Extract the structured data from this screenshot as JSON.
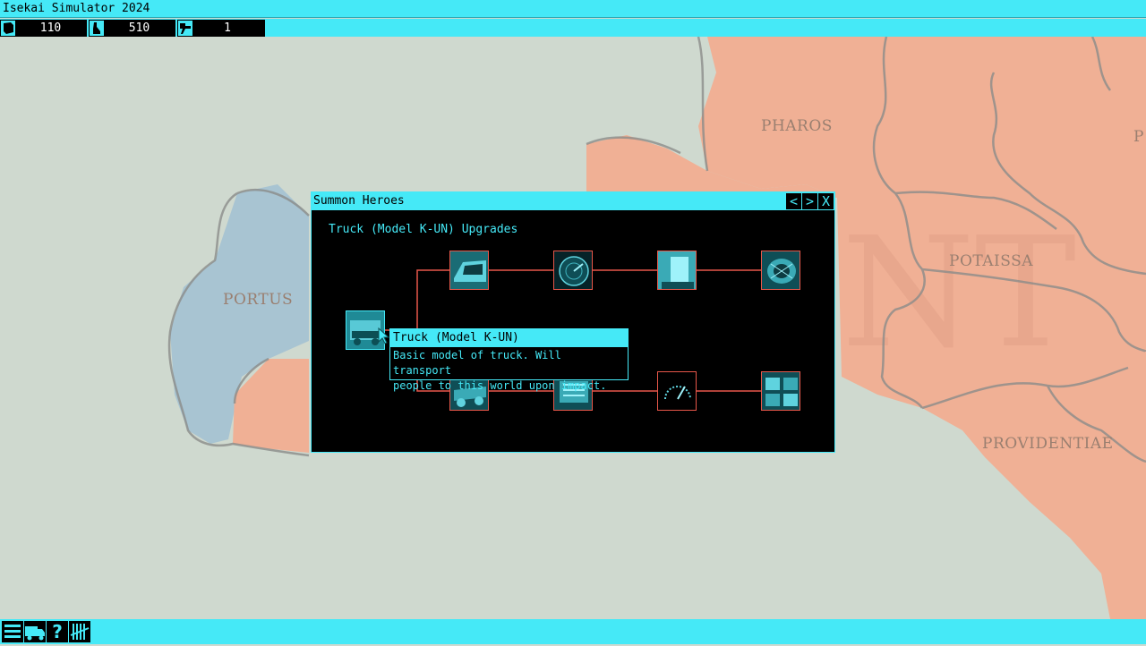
{
  "app": {
    "title": "Isekai Simulator 2024"
  },
  "resources": [
    {
      "icon": "shield-icon",
      "value": "110"
    },
    {
      "icon": "person-icon",
      "value": "510"
    },
    {
      "icon": "flag-icon",
      "value": "1"
    }
  ],
  "map": {
    "regions": [
      "PHAROS",
      "PORTUS",
      "POTAISSA",
      "PROVIDENTIAE",
      "P"
    ],
    "watermark": "NT"
  },
  "window": {
    "title": "Summon Heroes",
    "prev_label": "<",
    "next_label": ">",
    "close_label": "X",
    "subtitle": "Truck (Model K-UN) Upgrades"
  },
  "tree": {
    "root_icon": "truck-icon",
    "top_branch_icons": [
      "truck-cabin-icon",
      "radar-icon",
      "window-icon",
      "engine-icon"
    ],
    "bottom_branch_icons": [
      "chassis-icon",
      "motor-icon",
      "speedometer-icon",
      "tires-icon"
    ]
  },
  "tooltip": {
    "title": "Truck (Model K-UN)",
    "body_line1": "Basic model of truck. Will transport",
    "body_line2": "people to this world upon impact."
  },
  "bottom_bar": {
    "buttons": [
      "menu-icon",
      "truck-icon",
      "help-icon",
      "tally-icon"
    ],
    "help_label": "?"
  },
  "colors": {
    "ui_cyan": "#45e9f7",
    "node_border": "#e8574a",
    "map_land_salmon": "#f0b095",
    "map_water_blue": "#a8c4d2",
    "map_land_pale": "#cfd9cf"
  }
}
